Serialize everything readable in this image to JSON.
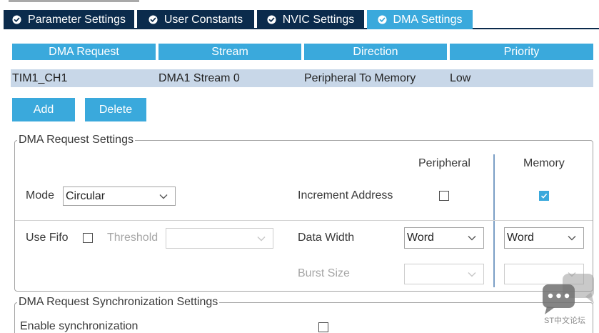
{
  "tabs": [
    {
      "label": "Parameter Settings",
      "active": false
    },
    {
      "label": "User Constants",
      "active": false
    },
    {
      "label": "NVIC Settings",
      "active": false
    },
    {
      "label": "DMA Settings",
      "active": true
    }
  ],
  "table": {
    "columns": [
      "DMA Request",
      "Stream",
      "Direction",
      "Priority"
    ],
    "rows": [
      {
        "request": "TIM1_CH1",
        "stream": "DMA1 Stream 0",
        "direction": "Peripheral To Memory",
        "priority": "Low",
        "selected": true
      }
    ]
  },
  "buttons": {
    "add": "Add",
    "delete": "Delete"
  },
  "request_settings": {
    "legend": "DMA Request Settings",
    "peripheral_header": "Peripheral",
    "memory_header": "Memory",
    "mode": {
      "label": "Mode",
      "value": "Circular"
    },
    "increment_address": {
      "label": "Increment Address",
      "peripheral": false,
      "memory": true
    },
    "use_fifo": {
      "label": "Use Fifo",
      "checked": false
    },
    "threshold": {
      "label": "Threshold",
      "enabled": false
    },
    "data_width": {
      "label": "Data Width",
      "peripheral": "Word",
      "memory": "Word"
    },
    "burst_size": {
      "label": "Burst Size",
      "enabled": false
    }
  },
  "sync_settings": {
    "legend": "DMA Request Synchronization Settings",
    "enable_synchronization": {
      "label": "Enable synchronization",
      "checked": false
    }
  },
  "watermark": {
    "text": "ST中文论坛"
  },
  "icons": {
    "tab_status": "check-circle-icon",
    "dropdown": "chevron-down-icon",
    "checkbox_mark": "checkmark-icon",
    "watermark": "chat-bubbles-icon"
  },
  "colors": {
    "navy": "#0b2b4c",
    "accent": "#3aa9dc",
    "selected_row": "#c8d7e8"
  }
}
